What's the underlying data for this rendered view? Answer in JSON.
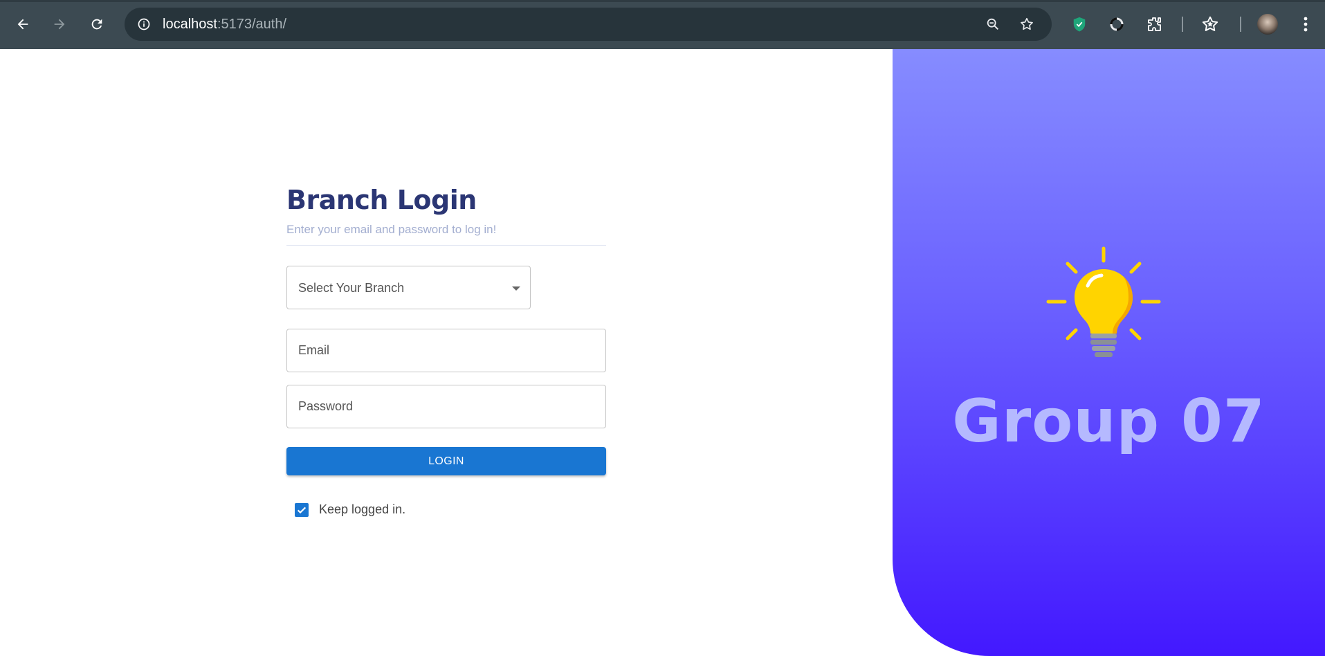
{
  "browser": {
    "url_host": "localhost",
    "url_path": ":5173/auth/"
  },
  "login": {
    "title": "Branch Login",
    "subtitle": "Enter your email and password to log in!",
    "branch_select": {
      "label": "Select Your Branch"
    },
    "email": {
      "placeholder": "Email"
    },
    "password": {
      "placeholder": "Password"
    },
    "login_button": "LOGIN",
    "keep_logged_in": {
      "label": "Keep logged in.",
      "checked": true
    }
  },
  "hero": {
    "icon": "light-bulb-icon",
    "text": "Group 07"
  },
  "colors": {
    "primary": "#1976d2",
    "title": "#2b3674",
    "subtitle": "#a3aed0",
    "hero_gradient_top": "#868cff",
    "hero_gradient_bottom": "#4318ff",
    "hero_text": "#b5b9ff"
  }
}
